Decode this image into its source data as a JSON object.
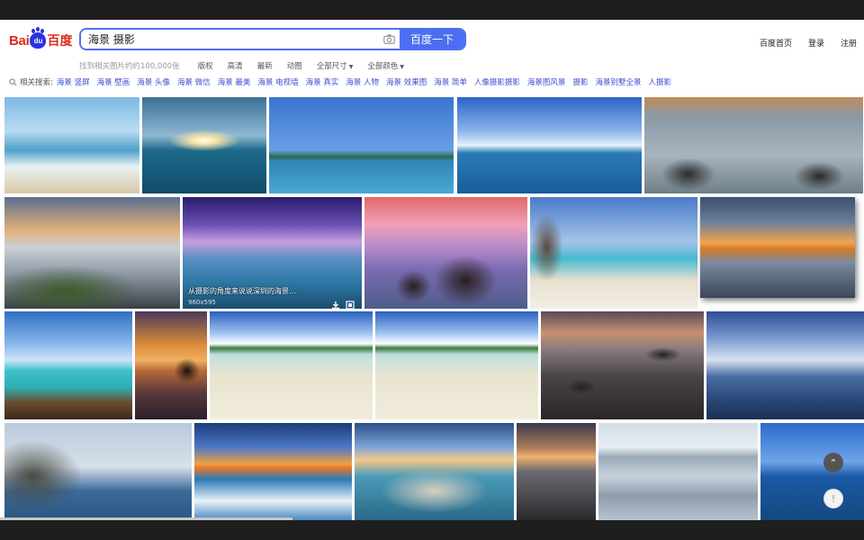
{
  "header": {
    "logo_bai": "Bai",
    "logo_du": "百度",
    "search_value": "海景 摄影",
    "search_button": "百度一下",
    "nav": [
      "百度首页",
      "登录",
      "注册"
    ]
  },
  "filters": {
    "count": "找到相关图片约约100,000张",
    "items": [
      "版权",
      "高清",
      "最新",
      "动图",
      "全部尺寸",
      "全部颜色"
    ]
  },
  "related": {
    "label": "相关搜索:",
    "tags": [
      "海景 竖屏",
      "海景 壁画",
      "海景 头像",
      "海景 微信",
      "海景 最美",
      "海景 电视墙",
      "海景 真实",
      "海景 人物",
      "海景 效果图",
      "海景 简单",
      "人像摄影摄影",
      "海景图风景",
      "摄影",
      "海景别墅全景",
      "人摄影"
    ]
  },
  "hovered": {
    "caption": "从摄影的角度来说说深圳的海景...",
    "size": "960x595"
  },
  "images": [
    {
      "name": "waves-beach"
    },
    {
      "name": "sunset-ocean"
    },
    {
      "name": "island-pier"
    },
    {
      "name": "blue-sea-clouds"
    },
    {
      "name": "misty-rocks"
    },
    {
      "name": "mossy-rocks-sunset"
    },
    {
      "name": "rocky-shore-long-exposure"
    },
    {
      "name": "sea-stacks-pink-sky"
    },
    {
      "name": "beach-rocks-cliff"
    },
    {
      "name": "dramatic-sunset-coast"
    },
    {
      "name": "wooden-pier"
    },
    {
      "name": "rock-reflection-sunset"
    },
    {
      "name": "white-sand-shallow-1"
    },
    {
      "name": "white-sand-shallow-2"
    },
    {
      "name": "wet-beach-rocks"
    },
    {
      "name": "boats-cloudy-sea"
    },
    {
      "name": "coastal-cliff-boat"
    },
    {
      "name": "sunset-waves"
    },
    {
      "name": "lake-boulders-sunset"
    },
    {
      "name": "rocky-coast-dusk"
    },
    {
      "name": "grey-sea-waves"
    },
    {
      "name": "blue-sea-horizon"
    }
  ],
  "fab": {
    "up": "⌃",
    "feedback": "!"
  }
}
